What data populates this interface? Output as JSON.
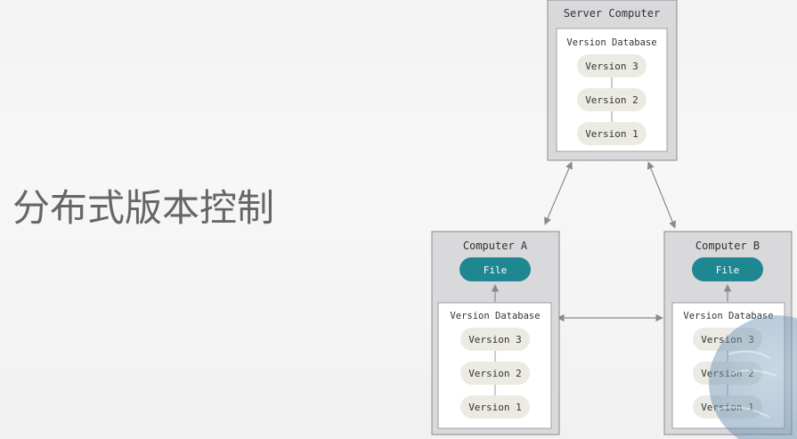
{
  "page": {
    "title": "分布式版本控制"
  },
  "diagram": {
    "server": {
      "label": "Server Computer",
      "database_label": "Version Database",
      "versions": [
        "Version 3",
        "Version 2",
        "Version 1"
      ]
    },
    "computer_a": {
      "label": "Computer A",
      "file_label": "File",
      "database_label": "Version Database",
      "versions": [
        "Version 3",
        "Version 2",
        "Version 1"
      ]
    },
    "computer_b": {
      "label": "Computer B",
      "file_label": "File",
      "database_label": "Version Database",
      "versions": [
        "Version 3",
        "Version 2",
        "Version 1"
      ]
    }
  },
  "colors": {
    "outer_box_fill": "#d9d9dc",
    "outer_box_stroke": "#8b8b8f",
    "inner_box_fill": "#ffffff",
    "inner_box_stroke": "#a0a0a4",
    "version_pill_fill": "#ecebe3",
    "file_pill_fill": "#1f8791",
    "file_text": "#ffffff",
    "text": "#333333",
    "arrow": "#8a8a8d",
    "title_text": "#6a6a6a",
    "webcam_overlay": "#6f97b7"
  }
}
